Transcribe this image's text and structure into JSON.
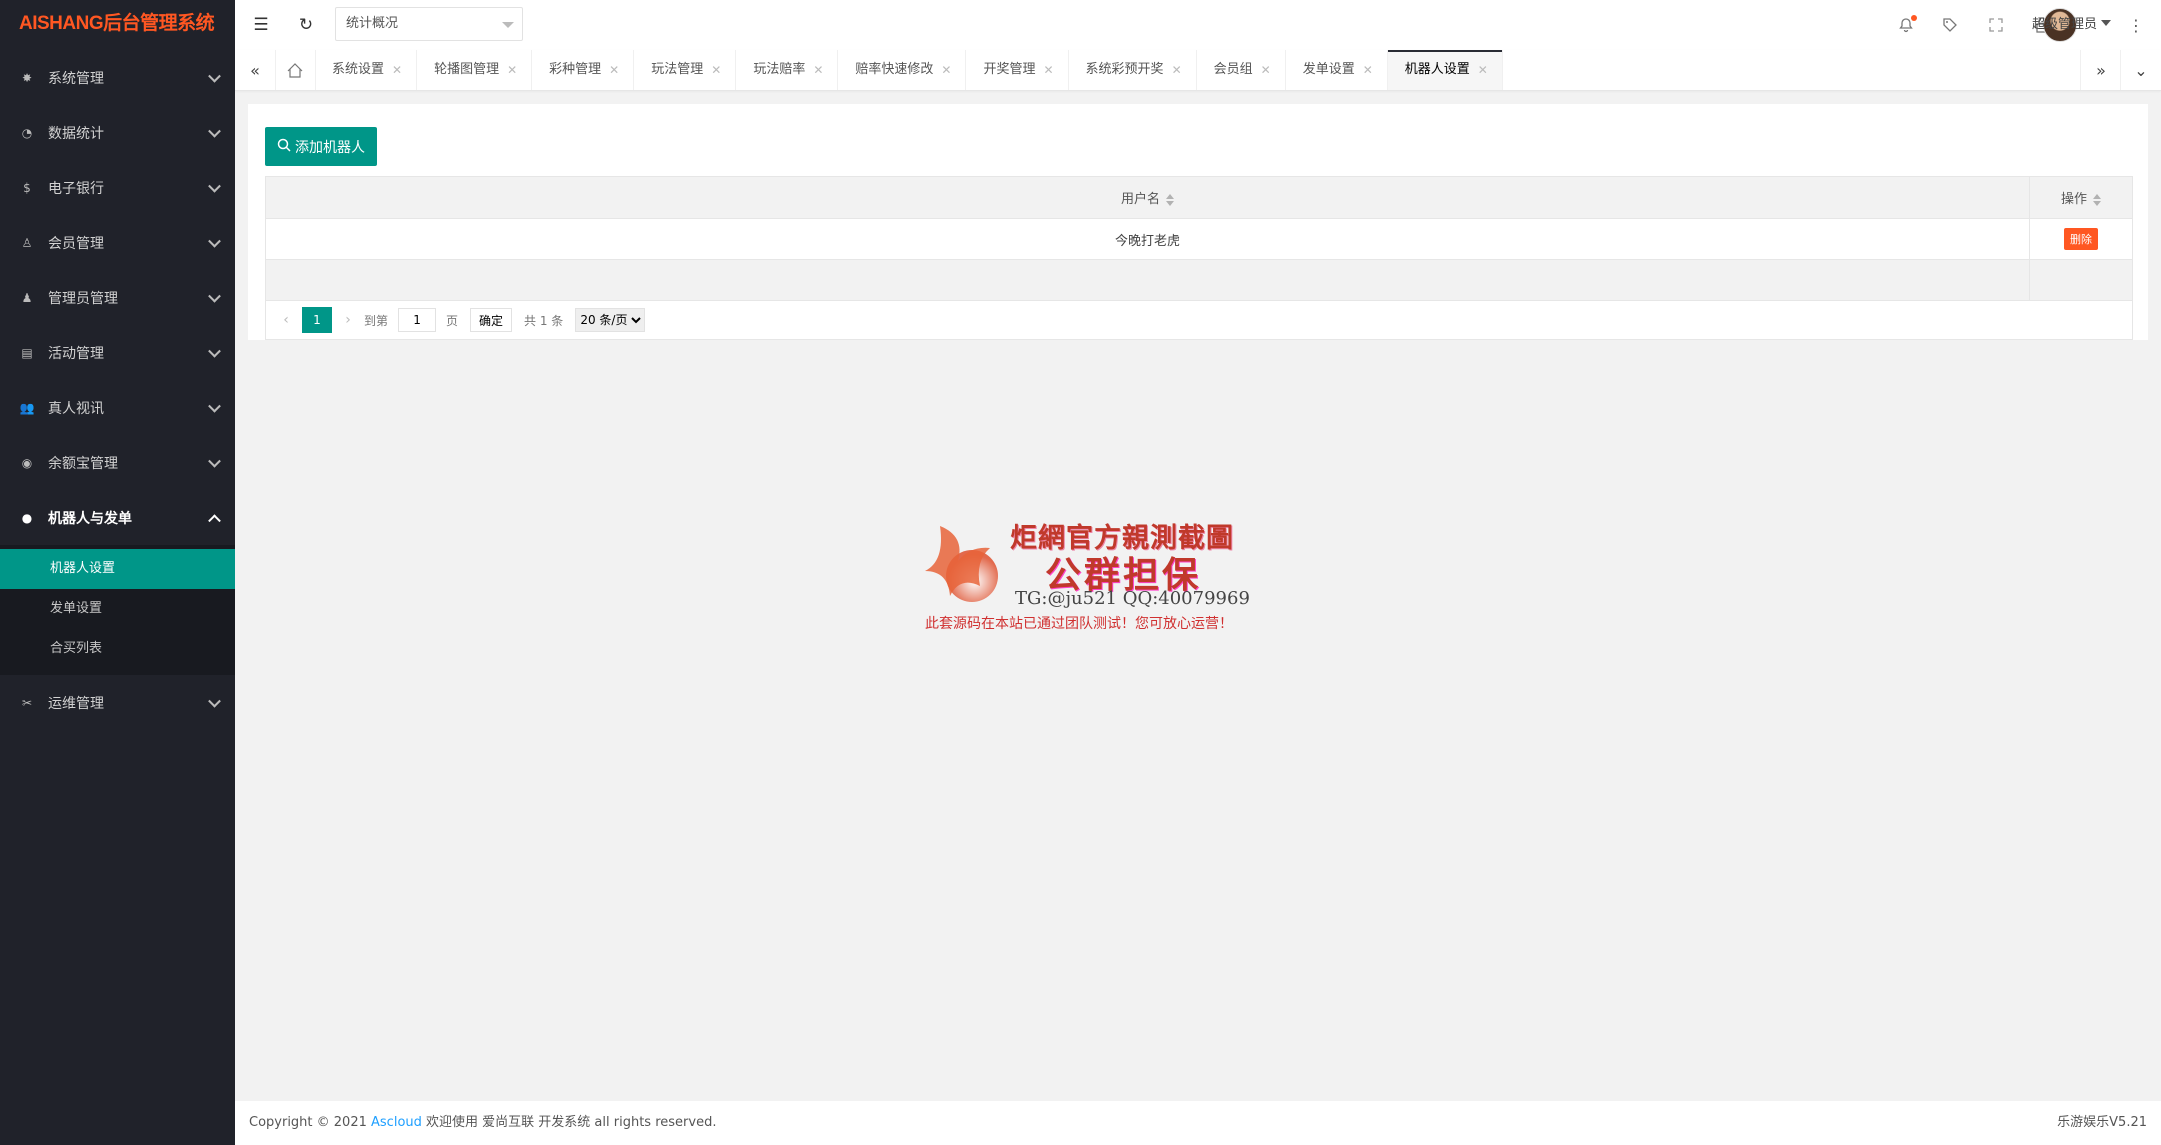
{
  "app": {
    "logo": "AISHANG后台管理系统"
  },
  "sidebar": {
    "items": [
      {
        "label": "系统管理",
        "icon": "gear-icon"
      },
      {
        "label": "数据统计",
        "icon": "dashboard-icon"
      },
      {
        "label": "电子银行",
        "icon": "dollar-icon"
      },
      {
        "label": "会员管理",
        "icon": "user-icon"
      },
      {
        "label": "管理员管理",
        "icon": "admin-icon"
      },
      {
        "label": "活动管理",
        "icon": "calendar-icon"
      },
      {
        "label": "真人视讯",
        "icon": "group-icon"
      },
      {
        "label": "余额宝管理",
        "icon": "coin-icon"
      },
      {
        "label": "机器人与发单",
        "icon": "person-icon"
      },
      {
        "label": "运维管理",
        "icon": "tools-icon"
      }
    ],
    "submenu": [
      {
        "label": "机器人设置"
      },
      {
        "label": "发单设置"
      },
      {
        "label": "合买列表"
      }
    ]
  },
  "header": {
    "select_value": "统计概况",
    "username": "超级管理员"
  },
  "tabs": [
    {
      "label": "系统设置"
    },
    {
      "label": "轮播图管理"
    },
    {
      "label": "彩种管理"
    },
    {
      "label": "玩法管理"
    },
    {
      "label": "玩法赔率"
    },
    {
      "label": "赔率快速修改"
    },
    {
      "label": "开奖管理"
    },
    {
      "label": "系统彩预开奖"
    },
    {
      "label": "会员组"
    },
    {
      "label": "发单设置"
    },
    {
      "label": "机器人设置"
    }
  ],
  "content": {
    "add_button": "添加机器人",
    "table": {
      "headers": {
        "username": "用户名",
        "action": "操作"
      },
      "rows": [
        {
          "username": "今晚打老虎",
          "action": "删除"
        }
      ]
    },
    "pager": {
      "current": "1",
      "goto_label": "到第",
      "goto_value": "1",
      "page_unit": "页",
      "confirm": "确定",
      "total": "共 1 条",
      "size_option": "20 条/页"
    }
  },
  "watermark": {
    "line1": "炬網官方親測截圖",
    "line2": "公群担保",
    "line3": "TG:@ju521    QQ:40079969",
    "line4": "此套源码在本站已通过团队测试！您可放心运营！"
  },
  "footer": {
    "prefix": "Copyright © 2021",
    "link": "Ascloud",
    "suffix": "欢迎使用 爱尚互联 开发系统 all rights reserved.",
    "version": "乐游娱乐V5.21"
  },
  "colors": {
    "sidebar_bg": "#20222a",
    "accent": "#009688",
    "danger": "#ff5722"
  }
}
